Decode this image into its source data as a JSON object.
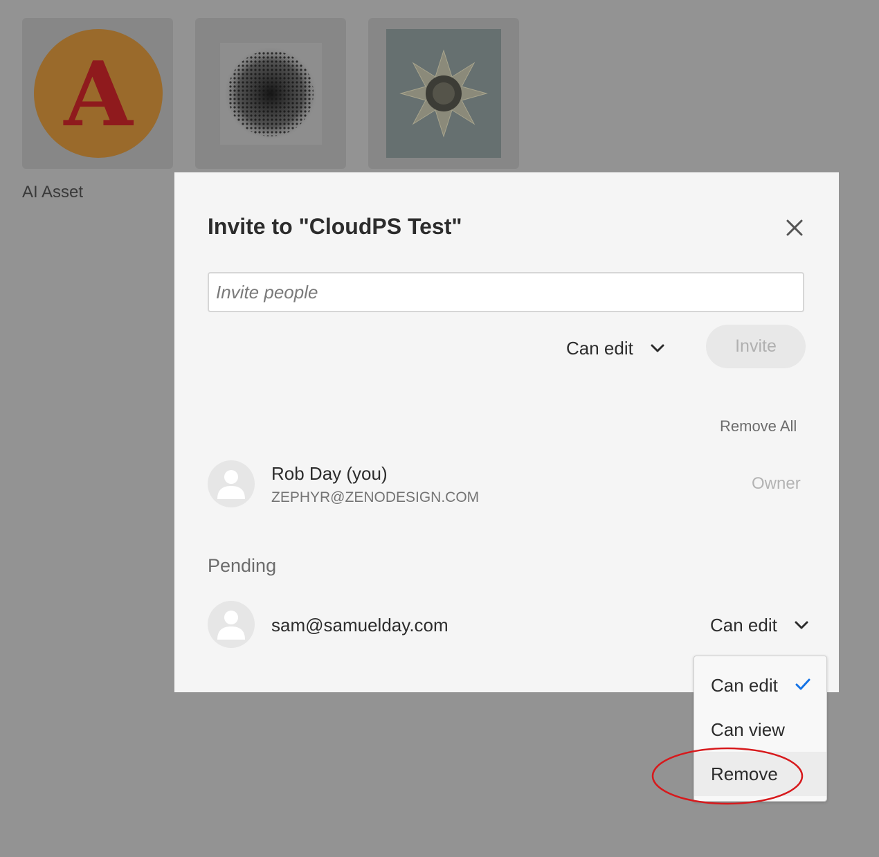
{
  "background": {
    "assets": [
      {
        "name": "AI Asset",
        "logo_letter": "A"
      },
      {
        "name": ""
      },
      {
        "name": ""
      }
    ]
  },
  "dialog": {
    "title": "Invite to \"CloudPS Test\"",
    "close_icon": "close-icon",
    "invite_placeholder": "Invite people",
    "permission_selected": "Can edit",
    "invite_button": "Invite",
    "remove_all": "Remove All",
    "owner": {
      "name": "Rob Day (you)",
      "email": "ZEPHYR@ZENODESIGN.COM",
      "role": "Owner"
    },
    "pending_label": "Pending",
    "pending": [
      {
        "email": "sam@samuelday.com",
        "permission": "Can edit"
      }
    ]
  },
  "menu": {
    "items": [
      {
        "label": "Can edit",
        "checked": true
      },
      {
        "label": "Can view"
      },
      {
        "label": "Remove"
      }
    ]
  },
  "colors": {
    "overlay": "#939393",
    "accent_check": "#1473e6",
    "annotation": "#d7191c"
  }
}
